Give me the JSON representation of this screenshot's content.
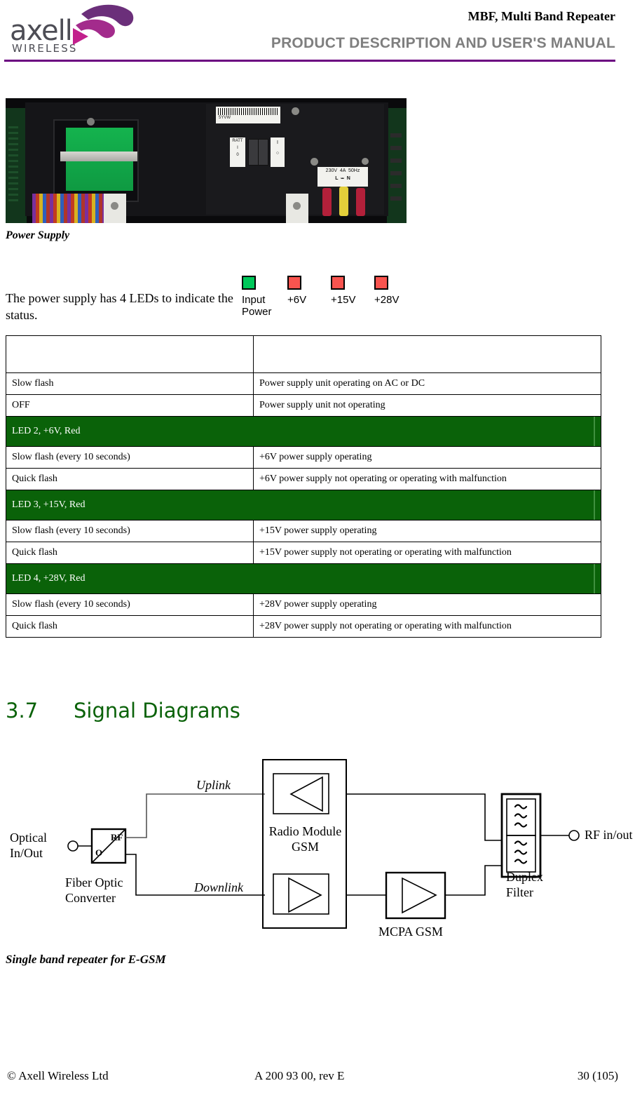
{
  "header": {
    "logo_word": "axell",
    "logo_sub": "WIRELESS",
    "title": "MBF, Multi Band Repeater",
    "subtitle": "PRODUCT DESCRIPTION AND USER'S MANUAL",
    "rule_color": "#6b0080"
  },
  "photo": {
    "caption": "Power Supply",
    "labels": {
      "ratt": "RATT",
      "ratt_on": "I",
      "ratt_off": "0",
      "breaker_on": "I",
      "mains_rating": "230V   4A   50Hz",
      "terminal_live": "L",
      "terminal_neutral": "N",
      "barcode_text": "5YVW"
    }
  },
  "intro": {
    "text": "The power supply has 4 LEDs to indicate the status."
  },
  "leds": [
    {
      "label": "Input\nPower",
      "color": "#00c85a"
    },
    {
      "label": "+6V",
      "color": "#f9544f"
    },
    {
      "label": "+15V",
      "color": "#f9544f"
    },
    {
      "label": "+28V",
      "color": "#f9544f"
    }
  ],
  "table": {
    "col1_header": "",
    "col2_header": "",
    "rows": [
      {
        "type": "blank",
        "c1": "",
        "c2": ""
      },
      {
        "type": "data",
        "c1": "Slow flash",
        "c2": "Power supply unit operating on AC or DC"
      },
      {
        "type": "data",
        "c1": "OFF",
        "c2": "Power supply unit not operating"
      },
      {
        "type": "section",
        "c1": "LED 2, +6V, Red"
      },
      {
        "type": "data",
        "c1": "Slow flash (every 10 seconds)",
        "c2": "+6V power supply operating"
      },
      {
        "type": "data",
        "c1": "Quick flash",
        "c2": "+6V power supply not operating or operating with malfunction"
      },
      {
        "type": "section",
        "c1": "LED 3, +15V, Red"
      },
      {
        "type": "data",
        "c1": "Slow flash (every 10 seconds)",
        "c2": "+15V power supply operating"
      },
      {
        "type": "data",
        "c1": "Quick flash",
        "c2": "+15V power supply not operating or operating with malfunction"
      },
      {
        "type": "section",
        "c1": "LED 4, +28V, Red"
      },
      {
        "type": "data",
        "c1": "Slow flash (every 10 seconds)",
        "c2": "+28V power supply operating"
      },
      {
        "type": "data",
        "c1": "Quick flash",
        "c2": "+28V power supply not operating or operating with malfunction"
      }
    ],
    "section_bg": "#0a6209"
  },
  "section": {
    "number": "3.7",
    "title": "Signal Diagrams",
    "color": "#0a6209"
  },
  "diagram": {
    "caption": "Single band repeater for E-GSM",
    "labels": {
      "optical_in_out": "Optical\nIn/Out",
      "fiber_optic_converter": "Fiber Optic\nConverter",
      "converter_rf": "RF",
      "converter_o": "O",
      "uplink": "Uplink",
      "downlink": "Downlink",
      "radio_module": "Radio Module\nGSM",
      "mcpa": "MCPA GSM",
      "duplex_filter": "Duplex\nFilter",
      "rf_in_out": "RF in/out"
    }
  },
  "footer": {
    "left": "© Axell Wireless Ltd",
    "middle": "A 200 93 00, rev E",
    "right": "30 (105)"
  }
}
